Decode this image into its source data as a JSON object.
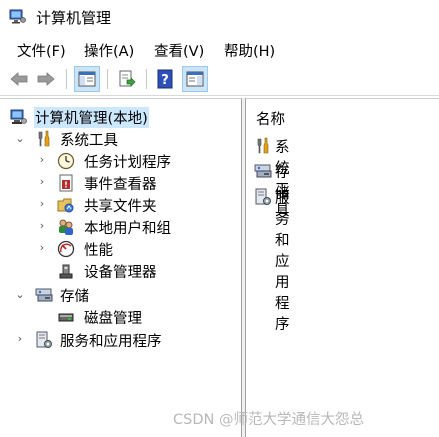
{
  "window": {
    "title": "计算机管理"
  },
  "menu": [
    "文件(F)",
    "操作(A)",
    "查看(V)",
    "帮助(H)"
  ],
  "toolbar": {
    "buttons": [
      "back-icon",
      "forward-icon",
      "show-hide-console-tree-icon",
      "export-list-icon",
      "help-icon",
      "show-hide-action-pane-icon"
    ]
  },
  "tree": {
    "root": "计算机管理(本地)",
    "system_tools": {
      "label": "系统工具",
      "children": [
        "任务计划程序",
        "事件查看器",
        "共享文件夹",
        "本地用户和组",
        "性能",
        "设备管理器"
      ]
    },
    "storage": {
      "label": "存储",
      "children": [
        "磁盘管理"
      ]
    },
    "services": {
      "label": "服务和应用程序"
    }
  },
  "content": {
    "column_header": "名称",
    "items": [
      "系统工具",
      "存储",
      "服务和应用程序"
    ]
  },
  "watermark": "CSDN @师范大学通信大怨总"
}
